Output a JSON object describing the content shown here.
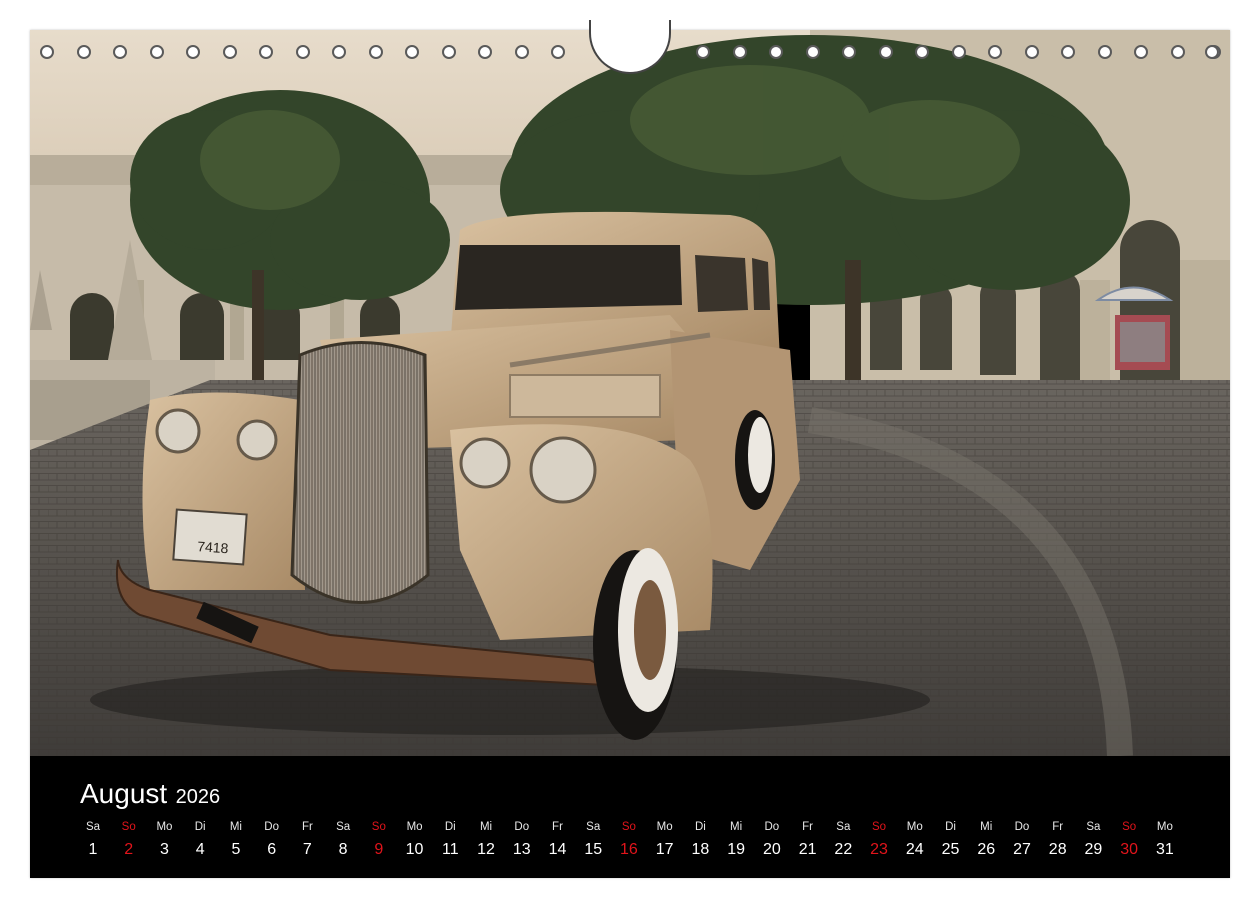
{
  "calendar": {
    "month": "August",
    "year": "2026",
    "weekend_color": "#e1141b",
    "days": [
      {
        "wd": "Sa",
        "n": "1",
        "sun": false
      },
      {
        "wd": "So",
        "n": "2",
        "sun": true
      },
      {
        "wd": "Mo",
        "n": "3",
        "sun": false
      },
      {
        "wd": "Di",
        "n": "4",
        "sun": false
      },
      {
        "wd": "Mi",
        "n": "5",
        "sun": false
      },
      {
        "wd": "Do",
        "n": "6",
        "sun": false
      },
      {
        "wd": "Fr",
        "n": "7",
        "sun": false
      },
      {
        "wd": "Sa",
        "n": "8",
        "sun": false
      },
      {
        "wd": "So",
        "n": "9",
        "sun": true
      },
      {
        "wd": "Mo",
        "n": "10",
        "sun": false
      },
      {
        "wd": "Di",
        "n": "11",
        "sun": false
      },
      {
        "wd": "Mi",
        "n": "12",
        "sun": false
      },
      {
        "wd": "Do",
        "n": "13",
        "sun": false
      },
      {
        "wd": "Fr",
        "n": "14",
        "sun": false
      },
      {
        "wd": "Sa",
        "n": "15",
        "sun": false
      },
      {
        "wd": "So",
        "n": "16",
        "sun": true
      },
      {
        "wd": "Mo",
        "n": "17",
        "sun": false
      },
      {
        "wd": "Di",
        "n": "18",
        "sun": false
      },
      {
        "wd": "Mi",
        "n": "19",
        "sun": false
      },
      {
        "wd": "Do",
        "n": "20",
        "sun": false
      },
      {
        "wd": "Fr",
        "n": "21",
        "sun": false
      },
      {
        "wd": "Sa",
        "n": "22",
        "sun": false
      },
      {
        "wd": "So",
        "n": "23",
        "sun": true
      },
      {
        "wd": "Mo",
        "n": "24",
        "sun": false
      },
      {
        "wd": "Di",
        "n": "25",
        "sun": false
      },
      {
        "wd": "Mi",
        "n": "26",
        "sun": false
      },
      {
        "wd": "Do",
        "n": "27",
        "sun": false
      },
      {
        "wd": "Fr",
        "n": "28",
        "sun": false
      },
      {
        "wd": "Sa",
        "n": "29",
        "sun": false
      },
      {
        "wd": "So",
        "n": "30",
        "sun": true
      },
      {
        "wd": "Mo",
        "n": "31",
        "sun": false
      }
    ]
  },
  "photo": {
    "subject": "vintage car in a cobblestone courtyard",
    "license_plate": "7418"
  },
  "binding": {
    "ring_holes": 32
  }
}
